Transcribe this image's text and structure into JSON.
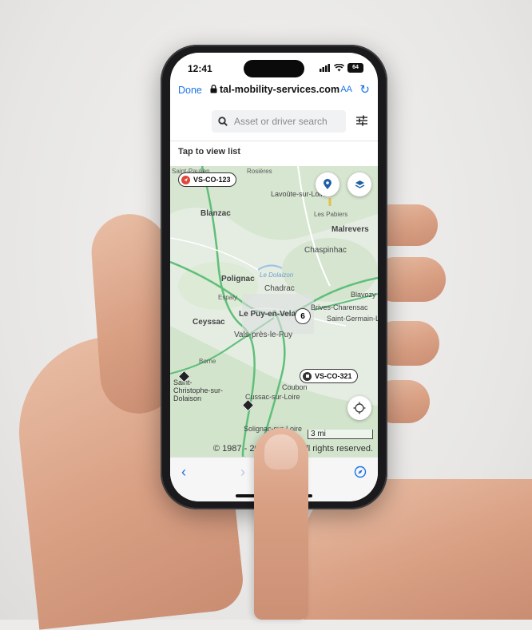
{
  "status_bar": {
    "time": "12:41",
    "battery": "64"
  },
  "browser": {
    "done_label": "Done",
    "url": "tal-mobility-services.com",
    "text_size_label": "AA",
    "back_icon": "chevron-left-icon",
    "forward_icon": "chevron-right-icon",
    "compass_icon": "compass-icon"
  },
  "search": {
    "placeholder": "Asset or driver search"
  },
  "list_toggle": {
    "label": "Tap to view list"
  },
  "map": {
    "vehicles": [
      {
        "label": "VS-CO-123",
        "status_color": "#e0463a"
      },
      {
        "label": "VS-CO-321",
        "status_color": "#333333"
      }
    ],
    "cluster_count": "6",
    "scale_label": "3 mi",
    "copyright": "© 1987 - 2024 HERE. All rights reserved.",
    "place_labels": [
      "Saint-Paulien",
      "Lavoûte-sur-Loire",
      "Blanzac",
      "Malrevers",
      "Chaspinhac",
      "Polignac",
      "Chadrac",
      "Brives-Charensac",
      "Ceyssac",
      "Le Puy-en-Velay",
      "Vals-près-le-Puy",
      "Saint-Germain-Laprade",
      "Blavozy",
      "Saint-Christophe-sur-Dolaison",
      "Cussac-sur-Loire",
      "Coubon",
      "Solignac-sur-Loire",
      "Borne",
      "Rosières",
      "Les Pabiers",
      "Espaly"
    ],
    "water_label": "Le Dolaizon"
  }
}
